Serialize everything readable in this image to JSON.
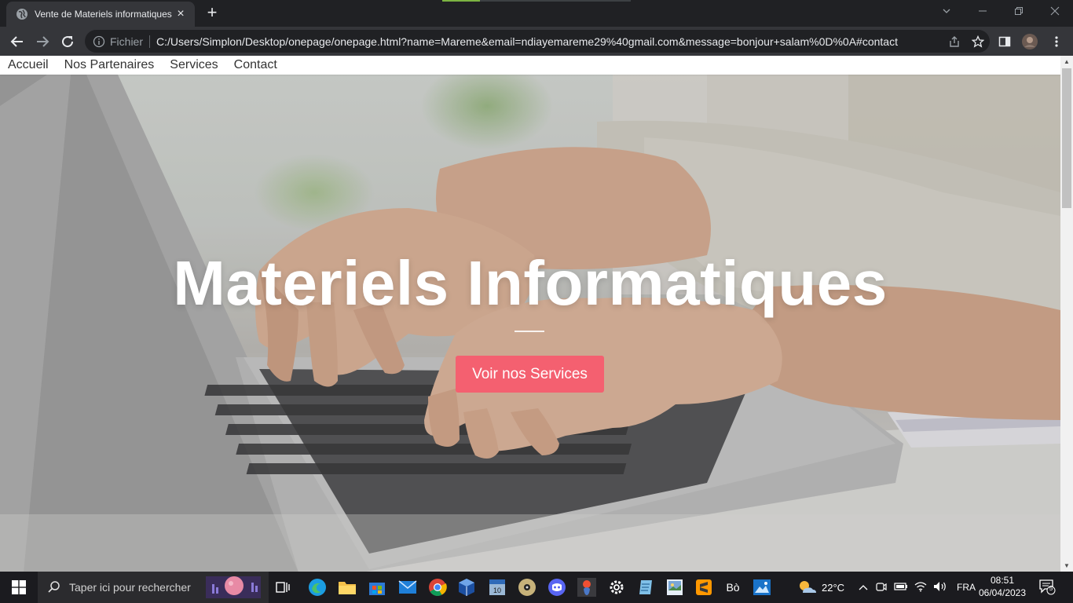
{
  "browser": {
    "tab_title": "Vente de Materiels informatiques",
    "scheme_label": "Fichier",
    "url": "C:/Users/Simplon/Desktop/onepage/onepage.html?name=Mareme&email=ndiayemareme29%40gmail.com&message=bonjour+salam%0D%0A#contact"
  },
  "page": {
    "nav": [
      "Accueil",
      "Nos Partenaires",
      "Services",
      "Contact"
    ],
    "hero_title": "Materiels Informatiques",
    "cta_label": "Voir nos Services",
    "cta_color": "#f46070"
  },
  "taskbar": {
    "search_placeholder": "Taper ici pour rechercher",
    "weather": "22°C",
    "language": "FRA",
    "time": "08:51",
    "date": "06/04/2023",
    "notification_count": "5",
    "pinned_apps": [
      "task-view-icon",
      "edge-icon",
      "file-explorer-icon",
      "store-icon",
      "mail-icon",
      "chrome-icon",
      "virtualbox-icon",
      "calendar-icon",
      "media-icon",
      "discord-icon",
      "git-icon",
      "settings-icon",
      "notepad-icon",
      "paint-icon",
      "sublime-icon",
      "app-icon",
      "photos-icon"
    ]
  }
}
